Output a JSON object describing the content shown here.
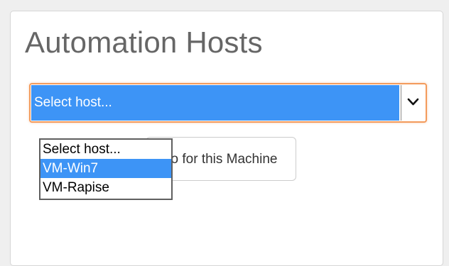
{
  "panel": {
    "title": "Automation Hosts"
  },
  "host_select": {
    "selected_value": "Select host...",
    "options": [
      {
        "label": "Select host...",
        "highlighted": false
      },
      {
        "label": "VM-Win7",
        "highlighted": true
      },
      {
        "label": "VM-Rapise",
        "highlighted": false
      }
    ]
  },
  "auto_button": {
    "visible_label": "Auto for this Machine"
  },
  "colors": {
    "accent_blue": "#3d94f6",
    "focus_orange": "#f39b5c",
    "title_gray": "#666666"
  },
  "icons": {
    "select_arrow": "chevron-down-icon"
  }
}
